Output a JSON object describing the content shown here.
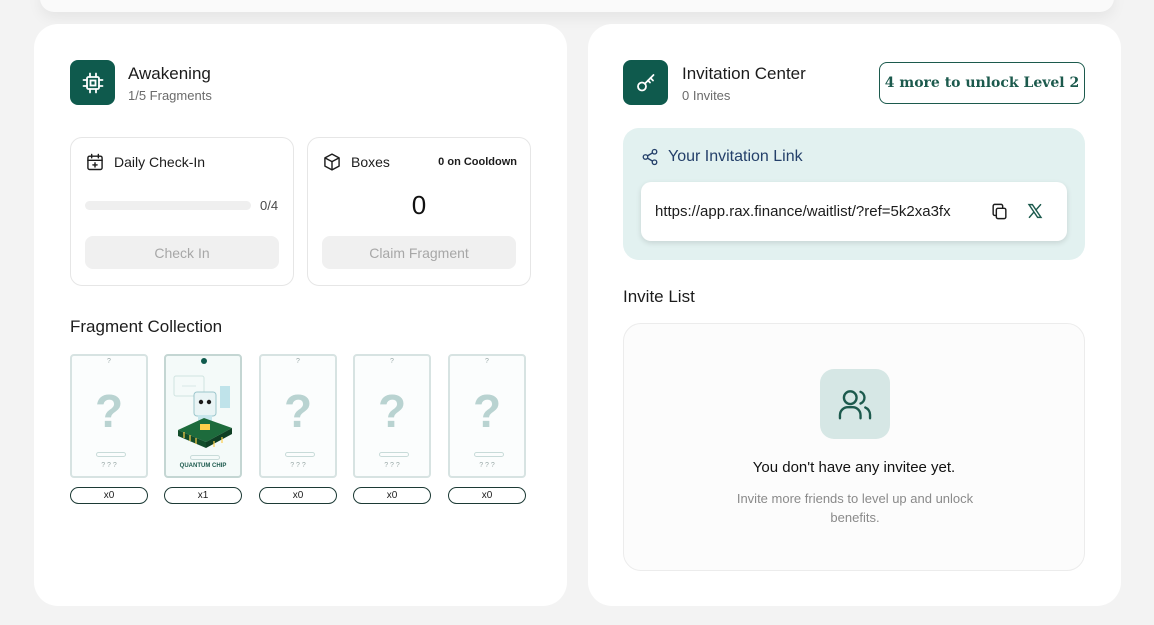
{
  "awakening": {
    "title": "Awakening",
    "subtitle": "1/5 Fragments",
    "checkin": {
      "title": "Daily Check-In",
      "progress_text": "0/4",
      "progress_fraction": 0,
      "button_label": "Check In"
    },
    "boxes": {
      "title": "Boxes",
      "cooldown": "0 on Cooldown",
      "count": "0",
      "button_label": "Claim Fragment"
    },
    "collection": {
      "title": "Fragment Collection",
      "fragments": [
        {
          "counter": "x0",
          "question": "?",
          "dots": "? ? ?"
        },
        {
          "counter": "x1",
          "name": "QUANTUM CHIP"
        },
        {
          "counter": "x0",
          "question": "?",
          "dots": "? ? ?"
        },
        {
          "counter": "x0",
          "question": "?",
          "dots": "? ? ?"
        },
        {
          "counter": "x0",
          "question": "?",
          "dots": "? ? ?"
        }
      ]
    }
  },
  "invitation": {
    "title": "Invitation Center",
    "subtitle": "0 Invites",
    "unlock_label": "4 more to unlock Level 2",
    "link_label": "Your Invitation Link",
    "link_url": "https://app.rax.finance/waitlist/?ref=5k2xa3fx",
    "invite_list_title": "Invite List",
    "empty_title": "You don't have any invitee yet.",
    "empty_subtitle": "Invite more friends to level up and unlock benefits."
  },
  "colors": {
    "brand": "#0f5a4d",
    "link_panel": "#e2f1f0",
    "link_label": "#24406a"
  }
}
